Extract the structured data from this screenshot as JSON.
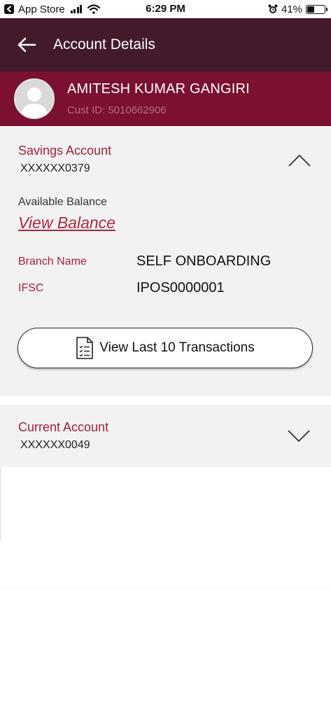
{
  "status_bar": {
    "back_app_label": "App Store",
    "time": "6:29 PM",
    "battery_text": "41%",
    "battery_level": 0.41
  },
  "header": {
    "title": "Account Details",
    "back_icon": "arrow-left-icon"
  },
  "profile": {
    "name": "AMITESH KUMAR GANGIRI",
    "cust_id": "Cust ID: 5010662906"
  },
  "savings": {
    "type": "Savings Account",
    "number": "XXXXXX0379",
    "available_balance_label": "Available Balance",
    "view_balance_label": "View Balance",
    "branch_label": "Branch Name",
    "branch_value": "SELF ONBOARDING",
    "ifsc_label": "IFSC",
    "ifsc_value": "IPOS0000001",
    "transactions_button": "View Last 10 Transactions",
    "expanded": true
  },
  "current": {
    "type": "Current Account",
    "number": "XXXXXX0049",
    "expanded": false
  },
  "colors": {
    "header_bg": "#431a2c",
    "profile_bg": "#7b1030",
    "accent_red": "#a5213f",
    "panel_bg": "#f2f2f2"
  }
}
